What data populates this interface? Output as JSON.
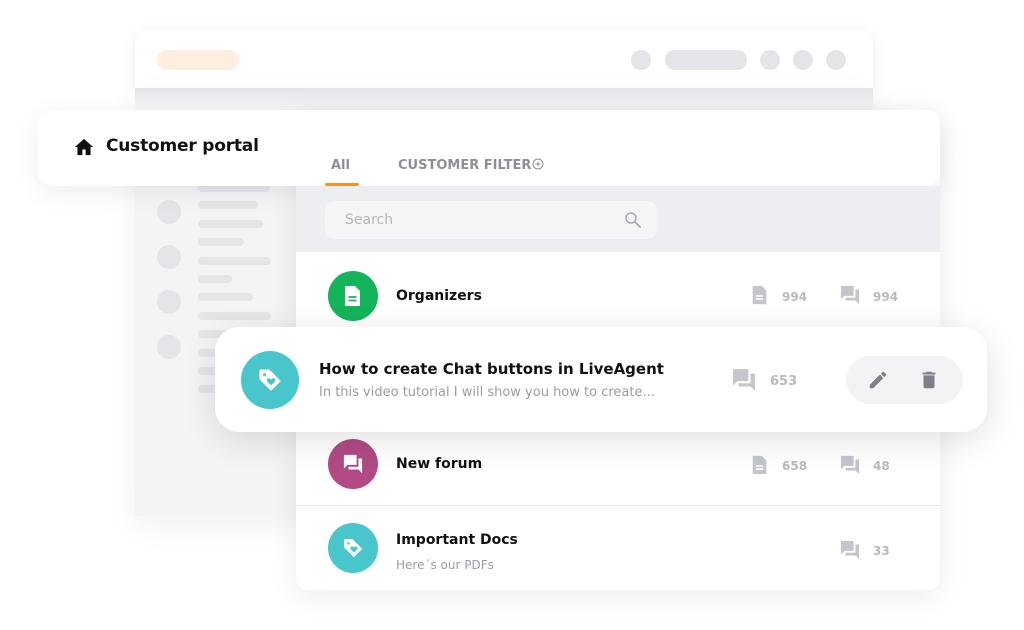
{
  "header": {
    "title": "Customer portal",
    "home_icon": "home-icon"
  },
  "tabs": [
    {
      "label": "All",
      "active": true
    },
    {
      "label": "CUSTOMER FILTER",
      "icon": "plus-circle-icon",
      "active": false
    }
  ],
  "search": {
    "placeholder": "Search",
    "value": "",
    "icon": "search-icon"
  },
  "colors": {
    "accent": "#f7931e",
    "green": "#14b45a",
    "teal": "#48c6cc",
    "magenta": "#b14a85"
  },
  "items": [
    {
      "title": "Organizers",
      "subtitle": "",
      "icon": "document-icon",
      "color": "#14b45a",
      "articles": "994",
      "topics": "994"
    },
    {
      "title": "How to create Chat buttons in LiveAgent",
      "subtitle": "In this video tutorial I will show you how to create...",
      "icon": "tag-heart-icon",
      "color": "#48c6cc",
      "topics": "653",
      "actions": [
        "edit",
        "delete"
      ],
      "highlighted": true
    },
    {
      "title": "New forum",
      "subtitle": "",
      "icon": "forum-icon",
      "color": "#b14a85",
      "articles": "658",
      "topics": "48"
    },
    {
      "title": "Important Docs",
      "subtitle": "Here´s our PDFs",
      "icon": "tag-heart-icon",
      "color": "#48c6cc",
      "topics": "33"
    }
  ]
}
